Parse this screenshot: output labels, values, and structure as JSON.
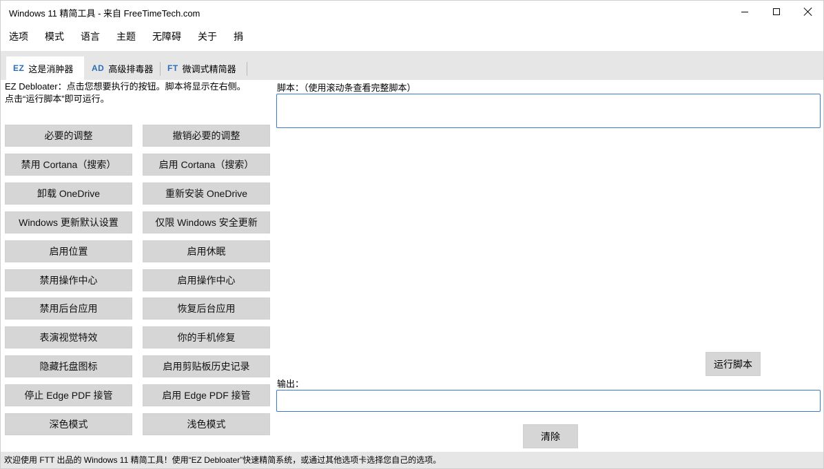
{
  "window": {
    "title": "Windows 11 精简工具 - 来自 FreeTimeTech.com"
  },
  "menu": [
    "选项",
    "模式",
    "语言",
    "主题",
    "无障碍",
    "关于",
    "捐"
  ],
  "tabs": [
    {
      "code": "EZ",
      "label": "这是消肿器"
    },
    {
      "code": "AD",
      "label": "高级排毒器"
    },
    {
      "code": "FT",
      "label": "微调式精简器"
    }
  ],
  "left": {
    "intro_line1": "EZ Debloater：点击您想要执行的按钮。脚本将显示在右侧。",
    "intro_line2": "点击“运行脚本”即可运行。",
    "buttons": [
      [
        "必要的调整",
        "撤销必要的调整"
      ],
      [
        "禁用 Cortana（搜索）",
        "启用 Cortana（搜索）"
      ],
      [
        "卸载 OneDrive",
        "重新安装 OneDrive"
      ],
      [
        "Windows 更新默认设置",
        "仅限 Windows 安全更新"
      ],
      [
        "启用位置",
        "启用休眠"
      ],
      [
        "禁用操作中心",
        "启用操作中心"
      ],
      [
        "禁用后台应用",
        "恢复后台应用"
      ],
      [
        "表演视觉特效",
        "你的手机修复"
      ],
      [
        "隐藏托盘图标",
        "启用剪贴板历史记录"
      ],
      [
        "停止 Edge PDF 接管",
        "启用 Edge PDF 接管"
      ],
      [
        "深色模式",
        "浅色模式"
      ]
    ]
  },
  "right": {
    "script_label": "脚本：（使用滚动条查看完整脚本）",
    "script_value": "",
    "run_button": "运行脚本",
    "output_label": "输出：",
    "output_value": "",
    "clear_button": "清除"
  },
  "status": "欢迎使用 FTT 出品的 Windows 11 精简工具！使用“EZ Debloater”快速精简系统，或通过其他选项卡选择您自己的选项。",
  "colors": {
    "accent": "#2a6db8",
    "tab_strip": "#e6e6e6",
    "button": "#d6d6d6",
    "input_border": "#3a7bc8"
  },
  "icons": [
    "minimize-icon",
    "maximize-icon",
    "close-icon"
  ]
}
